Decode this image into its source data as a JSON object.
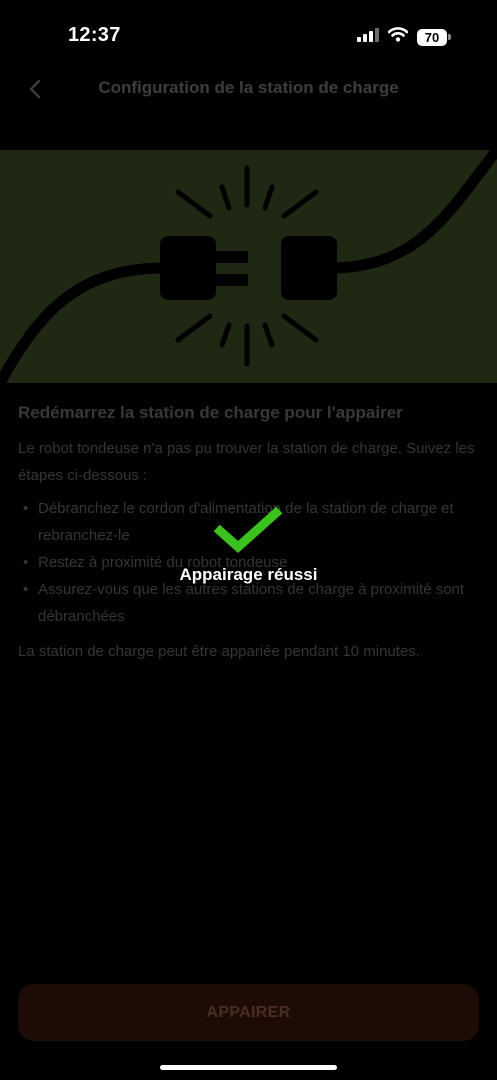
{
  "status_bar": {
    "time": "12:37",
    "battery_level": "70",
    "icons": [
      "signal-icon",
      "wifi-icon",
      "battery-icon"
    ]
  },
  "header": {
    "back_icon": "chevron-left-icon",
    "title": "Configuration de la station de charge"
  },
  "hero": {
    "icon": "unplugged-plug-illustration",
    "background_color": "#1e2812"
  },
  "content": {
    "heading": "Redémarrez la station de charge pour l'appairer",
    "intro": "Le robot tondeuse n'a pas pu trouver la station de charge. Suivez les étapes ci-dessous :",
    "steps": [
      "Débranchez le cordon d'alimentation de la station de charge et rebranchez-le",
      "Restez à proximité du robot tondeuse",
      "Assurez-vous que les autres stations de charge à proximité sont débranchées"
    ],
    "bullet": "•",
    "footnote": "La station de charge peut être appariée pendant 10  minutes."
  },
  "toast": {
    "icon": "checkmark-icon",
    "icon_color": "#3cc21f",
    "label": "Appairage réussi"
  },
  "footer": {
    "button_label": "APPAIRER",
    "button_color": "#1d0b05"
  }
}
